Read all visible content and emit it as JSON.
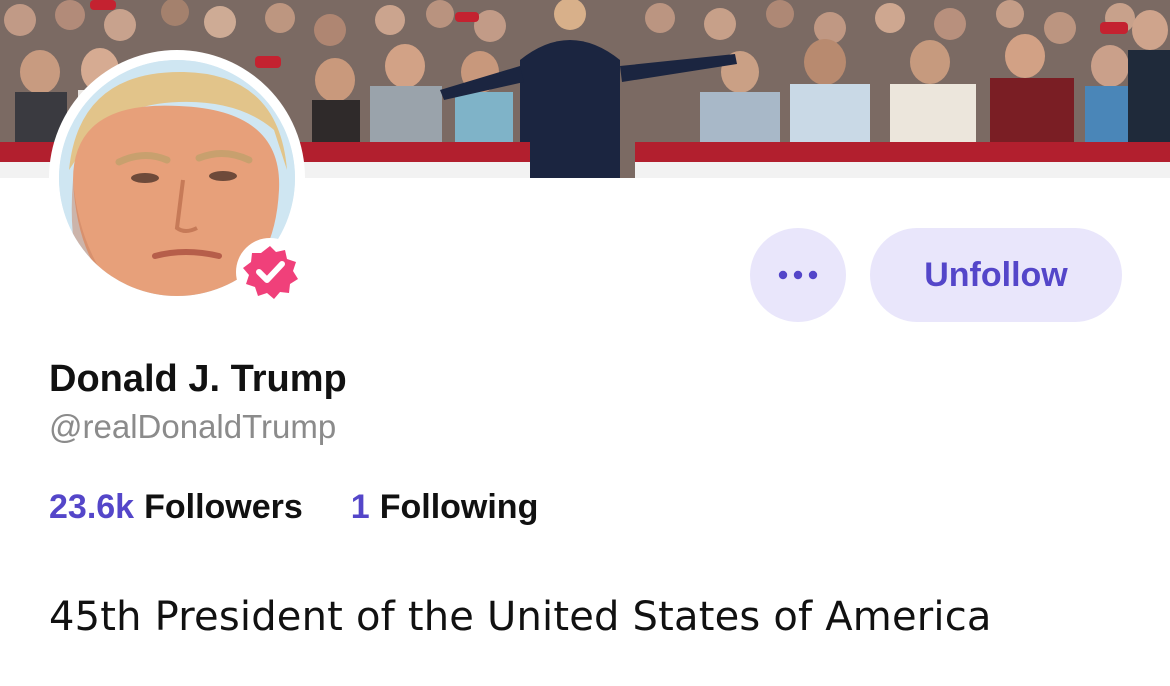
{
  "profile": {
    "display_name": "Donald J. Trump",
    "handle": "@realDonaldTrump",
    "verified": true,
    "bio": "45th President of the United States of America"
  },
  "stats": {
    "followers_count": "23.6k",
    "followers_label": "Followers",
    "following_count": "1",
    "following_label": "Following"
  },
  "actions": {
    "more_icon": "more-dots-icon",
    "unfollow_label": "Unfollow"
  },
  "colors": {
    "accent": "#5446c9",
    "button_bg": "#e9e6fb",
    "verified_badge": "#f0407a",
    "handle_text": "#8b8b8b"
  }
}
